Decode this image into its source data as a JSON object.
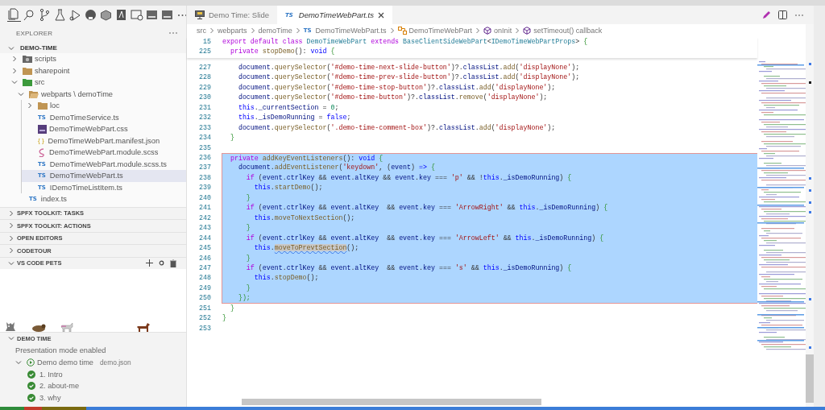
{
  "sidebar": {
    "title": "EXPLORER",
    "root": {
      "label": "DEMO-TIME",
      "expanded": true
    },
    "tree": [
      {
        "label": "scripts",
        "kind": "folder-gear",
        "expanded": false,
        "selected": false
      },
      {
        "label": "sharepoint",
        "kind": "folder",
        "expanded": false,
        "selected": false
      },
      {
        "label": "src",
        "kind": "folder-green",
        "expanded": true,
        "selected": false,
        "children": [
          {
            "label": "webparts \\ demoTime",
            "kind": "folder-open",
            "expanded": true,
            "selected": false,
            "children": [
              {
                "label": "loc",
                "kind": "folder",
                "expanded": false,
                "selected": false
              },
              {
                "label": "DemoTimeService.ts",
                "kind": "ts",
                "badge": "TS",
                "selected": false
              },
              {
                "label": "DemoTimeWebPart.css",
                "kind": "css",
                "selected": false
              },
              {
                "label": "DemoTimeWebPart.manifest.json",
                "kind": "json",
                "badge": "{ }",
                "selected": false
              },
              {
                "label": "DemoTimeWebPart.module.scss",
                "kind": "sass",
                "selected": false
              },
              {
                "label": "DemoTimeWebPart.module.scss.ts",
                "kind": "ts",
                "badge": "TS",
                "selected": false
              },
              {
                "label": "DemoTimeWebPart.ts",
                "kind": "ts",
                "badge": "TS",
                "selected": true
              },
              {
                "label": "IDemoTimeListItem.ts",
                "kind": "ts",
                "badge": "TS",
                "selected": false
              }
            ]
          },
          {
            "label": "index.ts",
            "kind": "ts",
            "badge": "TS",
            "selected": false
          }
        ]
      }
    ],
    "panels": [
      {
        "kind": "header",
        "title": "SPFX TOOLKIT: TASKS",
        "expanded": false
      },
      {
        "kind": "header",
        "title": "SPFX TOOLKIT: ACTIONS",
        "expanded": false
      },
      {
        "kind": "header",
        "title": "OPEN EDITORS",
        "expanded": false
      },
      {
        "kind": "header",
        "title": "CODETOUR",
        "expanded": false
      },
      {
        "kind": "pets",
        "title": "VS CODE PETS",
        "expanded": true
      },
      {
        "kind": "demo",
        "title": "DEMO TIME",
        "expanded": true,
        "status": "Presentation mode enabled",
        "demo": {
          "label": "Demo demo time",
          "file": "demo.json",
          "expanded": true,
          "steps": [
            {
              "label": "1. Intro",
              "done": true
            },
            {
              "label": "2. about-me",
              "done": true
            },
            {
              "label": "3. why",
              "done": true
            }
          ]
        }
      }
    ]
  },
  "tabs": [
    {
      "label": "Demo Time: Slide",
      "kind": "slide",
      "selected": false
    },
    {
      "label": "DemoTimeWebPart.ts",
      "kind": "ts",
      "badge": "TS",
      "selected": true
    }
  ],
  "breadcrumbs": [
    {
      "label": "src",
      "kind": "folder"
    },
    {
      "label": "webparts",
      "kind": "folder"
    },
    {
      "label": "demoTime",
      "kind": "folder"
    },
    {
      "label": "DemoTimeWebPart.ts",
      "kind": "ts",
      "badge": "TS"
    },
    {
      "label": "DemoTimeWebPart",
      "kind": "class"
    },
    {
      "label": "onInit",
      "kind": "method"
    },
    {
      "label": "setTimeout() callback",
      "kind": "method"
    }
  ],
  "sticky": [
    {
      "number": "15",
      "tokens": [
        {
          "kind": "k",
          "text": "export "
        },
        {
          "kind": "k",
          "text": "default "
        },
        {
          "kind": "k",
          "text": "class "
        },
        {
          "kind": "t",
          "text": "DemoTimeWebPart "
        },
        {
          "kind": "k",
          "text": "extends "
        },
        {
          "kind": "t",
          "text": "BaseClientSideWebPart"
        },
        {
          "kind": "p",
          "text": "<"
        },
        {
          "kind": "t",
          "text": "IDemoTimeWebPartProps"
        },
        {
          "kind": "p",
          "text": "> "
        },
        {
          "kind": "r",
          "text": "{"
        }
      ]
    },
    {
      "number": "225",
      "tokens": [
        {
          "kind": "k",
          "text": "  private "
        },
        {
          "kind": "f",
          "text": "stopDemo"
        },
        {
          "kind": "p",
          "text": "(): "
        },
        {
          "kind": "b",
          "text": "void "
        },
        {
          "kind": "r",
          "text": "{"
        }
      ]
    }
  ],
  "lines": [
    {
      "number": "227",
      "selected": false,
      "tokens": [
        {
          "kind": "i",
          "text": "    document"
        },
        {
          "kind": "p",
          "text": "."
        },
        {
          "kind": "f",
          "text": "querySelector"
        },
        {
          "kind": "p",
          "text": "("
        },
        {
          "kind": "s",
          "text": "'#demo-time-next-slide-button'"
        },
        {
          "kind": "p",
          "text": ")?."
        },
        {
          "kind": "i",
          "text": "classList"
        },
        {
          "kind": "p",
          "text": "."
        },
        {
          "kind": "f",
          "text": "add"
        },
        {
          "kind": "p",
          "text": "("
        },
        {
          "kind": "s",
          "text": "'displayNone'"
        },
        {
          "kind": "p",
          "text": ");"
        }
      ]
    },
    {
      "number": "228",
      "selected": false,
      "tokens": [
        {
          "kind": "i",
          "text": "    document"
        },
        {
          "kind": "p",
          "text": "."
        },
        {
          "kind": "f",
          "text": "querySelector"
        },
        {
          "kind": "p",
          "text": "("
        },
        {
          "kind": "s",
          "text": "'#demo-time-prev-slide-button'"
        },
        {
          "kind": "p",
          "text": ")?."
        },
        {
          "kind": "i",
          "text": "classList"
        },
        {
          "kind": "p",
          "text": "."
        },
        {
          "kind": "f",
          "text": "add"
        },
        {
          "kind": "p",
          "text": "("
        },
        {
          "kind": "s",
          "text": "'displayNone'"
        },
        {
          "kind": "p",
          "text": ");"
        }
      ]
    },
    {
      "number": "229",
      "selected": false,
      "tokens": [
        {
          "kind": "i",
          "text": "    document"
        },
        {
          "kind": "p",
          "text": "."
        },
        {
          "kind": "f",
          "text": "querySelector"
        },
        {
          "kind": "p",
          "text": "("
        },
        {
          "kind": "s",
          "text": "'#demo-time-stop-button'"
        },
        {
          "kind": "p",
          "text": ")?."
        },
        {
          "kind": "i",
          "text": "classList"
        },
        {
          "kind": "p",
          "text": "."
        },
        {
          "kind": "f",
          "text": "add"
        },
        {
          "kind": "p",
          "text": "("
        },
        {
          "kind": "s",
          "text": "'displayNone'"
        },
        {
          "kind": "p",
          "text": ");"
        }
      ]
    },
    {
      "number": "230",
      "selected": false,
      "tokens": [
        {
          "kind": "i",
          "text": "    document"
        },
        {
          "kind": "p",
          "text": "."
        },
        {
          "kind": "f",
          "text": "querySelector"
        },
        {
          "kind": "p",
          "text": "("
        },
        {
          "kind": "s",
          "text": "'#demo-time-button'"
        },
        {
          "kind": "p",
          "text": ")?."
        },
        {
          "kind": "i",
          "text": "classList"
        },
        {
          "kind": "p",
          "text": "."
        },
        {
          "kind": "f",
          "text": "remove"
        },
        {
          "kind": "p",
          "text": "("
        },
        {
          "kind": "s",
          "text": "'displayNone'"
        },
        {
          "kind": "p",
          "text": ");"
        }
      ]
    },
    {
      "number": "231",
      "selected": false,
      "tokens": [
        {
          "kind": "b",
          "text": "    this"
        },
        {
          "kind": "p",
          "text": "."
        },
        {
          "kind": "i",
          "text": "_currentSection"
        },
        {
          "kind": "p",
          "text": " = "
        },
        {
          "kind": "n",
          "text": "0"
        },
        {
          "kind": "p",
          "text": ";"
        }
      ]
    },
    {
      "number": "232",
      "selected": false,
      "tokens": [
        {
          "kind": "b",
          "text": "    this"
        },
        {
          "kind": "p",
          "text": "."
        },
        {
          "kind": "i",
          "text": "_isDemoRunning"
        },
        {
          "kind": "p",
          "text": " = "
        },
        {
          "kind": "b",
          "text": "false"
        },
        {
          "kind": "p",
          "text": ";"
        }
      ]
    },
    {
      "number": "233",
      "selected": false,
      "tokens": [
        {
          "kind": "i",
          "text": "    document"
        },
        {
          "kind": "p",
          "text": "."
        },
        {
          "kind": "f",
          "text": "querySelector"
        },
        {
          "kind": "p",
          "text": "("
        },
        {
          "kind": "s",
          "text": "'.demo-time-comment-box'"
        },
        {
          "kind": "p",
          "text": ")?."
        },
        {
          "kind": "i",
          "text": "classList"
        },
        {
          "kind": "p",
          "text": "."
        },
        {
          "kind": "f",
          "text": "add"
        },
        {
          "kind": "p",
          "text": "("
        },
        {
          "kind": "s",
          "text": "'displayNone'"
        },
        {
          "kind": "p",
          "text": ");"
        }
      ]
    },
    {
      "number": "234",
      "selected": false,
      "tokens": [
        {
          "kind": "r",
          "text": "  }"
        }
      ]
    },
    {
      "number": "235",
      "selected": false
    },
    {
      "number": "236",
      "selected": true,
      "tokens": [
        {
          "kind": "k",
          "text": "  private "
        },
        {
          "kind": "f",
          "text": "addKeyEventListeners"
        },
        {
          "kind": "p",
          "text": "(): "
        },
        {
          "kind": "b",
          "text": "void "
        },
        {
          "kind": "r",
          "text": "{"
        }
      ]
    },
    {
      "number": "237",
      "selected": true,
      "tokens": [
        {
          "kind": "i",
          "text": "    document"
        },
        {
          "kind": "p",
          "text": "."
        },
        {
          "kind": "f",
          "text": "addEventListener"
        },
        {
          "kind": "p",
          "text": "("
        },
        {
          "kind": "s",
          "text": "'keydown'"
        },
        {
          "kind": "p",
          "text": ", ("
        },
        {
          "kind": "i",
          "text": "event"
        },
        {
          "kind": "p",
          "text": ") "
        },
        {
          "kind": "b",
          "text": "=>"
        },
        {
          "kind": "r",
          "text": " {"
        }
      ]
    },
    {
      "number": "238",
      "selected": true,
      "tokens": [
        {
          "kind": "k",
          "text": "      if "
        },
        {
          "kind": "p",
          "text": "("
        },
        {
          "kind": "i",
          "text": "event"
        },
        {
          "kind": "p",
          "text": "."
        },
        {
          "kind": "i",
          "text": "ctrlKey"
        },
        {
          "kind": "p",
          "text": " && "
        },
        {
          "kind": "i",
          "text": "event"
        },
        {
          "kind": "p",
          "text": "."
        },
        {
          "kind": "i",
          "text": "altKey"
        },
        {
          "kind": "p",
          "text": " && "
        },
        {
          "kind": "i",
          "text": "event"
        },
        {
          "kind": "p",
          "text": "."
        },
        {
          "kind": "i",
          "text": "key"
        },
        {
          "kind": "p",
          "text": " === "
        },
        {
          "kind": "s",
          "text": "'p'"
        },
        {
          "kind": "p",
          "text": " && !"
        },
        {
          "kind": "b",
          "text": "this"
        },
        {
          "kind": "p",
          "text": "."
        },
        {
          "kind": "i",
          "text": "_isDemoRunning"
        },
        {
          "kind": "p",
          "text": ") "
        },
        {
          "kind": "r",
          "text": "{"
        }
      ]
    },
    {
      "number": "239",
      "selected": true,
      "tokens": [
        {
          "kind": "b",
          "text": "        this"
        },
        {
          "kind": "p",
          "text": "."
        },
        {
          "kind": "f",
          "text": "startDemo"
        },
        {
          "kind": "p",
          "text": "();"
        }
      ]
    },
    {
      "number": "240",
      "selected": true,
      "tokens": [
        {
          "kind": "r",
          "text": "      }"
        }
      ]
    },
    {
      "number": "241",
      "selected": true,
      "tokens": [
        {
          "kind": "k",
          "text": "      if "
        },
        {
          "kind": "p",
          "text": "("
        },
        {
          "kind": "i",
          "text": "event"
        },
        {
          "kind": "p",
          "text": "."
        },
        {
          "kind": "i",
          "text": "ctrlKey"
        },
        {
          "kind": "p",
          "text": " && "
        },
        {
          "kind": "i",
          "text": "event"
        },
        {
          "kind": "p",
          "text": "."
        },
        {
          "kind": "i",
          "text": "altKey"
        },
        {
          "kind": "p",
          "text": "  && "
        },
        {
          "kind": "i",
          "text": "event"
        },
        {
          "kind": "p",
          "text": "."
        },
        {
          "kind": "i",
          "text": "key"
        },
        {
          "kind": "p",
          "text": " === "
        },
        {
          "kind": "s",
          "text": "'ArrowRight'"
        },
        {
          "kind": "p",
          "text": " && "
        },
        {
          "kind": "b",
          "text": "this"
        },
        {
          "kind": "p",
          "text": "."
        },
        {
          "kind": "i",
          "text": "_isDemoRunning"
        },
        {
          "kind": "p",
          "text": ") "
        },
        {
          "kind": "r",
          "text": "{"
        }
      ]
    },
    {
      "number": "242",
      "selected": true,
      "tokens": [
        {
          "kind": "b",
          "text": "        this"
        },
        {
          "kind": "p",
          "text": "."
        },
        {
          "kind": "f",
          "text": "moveToNextSection"
        },
        {
          "kind": "p",
          "text": "();"
        }
      ]
    },
    {
      "number": "243",
      "selected": true,
      "tokens": [
        {
          "kind": "r",
          "text": "      }"
        }
      ]
    },
    {
      "number": "244",
      "selected": true,
      "tokens": [
        {
          "kind": "k",
          "text": "      if "
        },
        {
          "kind": "p",
          "text": "("
        },
        {
          "kind": "i",
          "text": "event"
        },
        {
          "kind": "p",
          "text": "."
        },
        {
          "kind": "i",
          "text": "ctrlKey"
        },
        {
          "kind": "p",
          "text": " && "
        },
        {
          "kind": "i",
          "text": "event"
        },
        {
          "kind": "p",
          "text": "."
        },
        {
          "kind": "i",
          "text": "altKey"
        },
        {
          "kind": "p",
          "text": "  && "
        },
        {
          "kind": "i",
          "text": "event"
        },
        {
          "kind": "p",
          "text": "."
        },
        {
          "kind": "i",
          "text": "key"
        },
        {
          "kind": "p",
          "text": " === "
        },
        {
          "kind": "s",
          "text": "'ArrowLeft'"
        },
        {
          "kind": "p",
          "text": " && "
        },
        {
          "kind": "b",
          "text": "this"
        },
        {
          "kind": "p",
          "text": "."
        },
        {
          "kind": "i",
          "text": "_isDemoRunning"
        },
        {
          "kind": "p",
          "text": ") "
        },
        {
          "kind": "r",
          "text": "{"
        }
      ]
    },
    {
      "number": "245",
      "selected": true,
      "tokens": [
        {
          "kind": "b",
          "text": "        this"
        },
        {
          "kind": "p",
          "text": "."
        },
        {
          "kind": "h",
          "text": "moveToPrevtSection"
        },
        {
          "kind": "p",
          "text": "();"
        }
      ]
    },
    {
      "number": "246",
      "selected": true,
      "tokens": [
        {
          "kind": "r",
          "text": "      }"
        }
      ]
    },
    {
      "number": "247",
      "selected": true,
      "tokens": [
        {
          "kind": "k",
          "text": "      if "
        },
        {
          "kind": "p",
          "text": "("
        },
        {
          "kind": "i",
          "text": "event"
        },
        {
          "kind": "p",
          "text": "."
        },
        {
          "kind": "i",
          "text": "ctrlKey"
        },
        {
          "kind": "p",
          "text": " && "
        },
        {
          "kind": "i",
          "text": "event"
        },
        {
          "kind": "p",
          "text": "."
        },
        {
          "kind": "i",
          "text": "altKey"
        },
        {
          "kind": "p",
          "text": "  && "
        },
        {
          "kind": "i",
          "text": "event"
        },
        {
          "kind": "p",
          "text": "."
        },
        {
          "kind": "i",
          "text": "key"
        },
        {
          "kind": "p",
          "text": " === "
        },
        {
          "kind": "s",
          "text": "'s'"
        },
        {
          "kind": "p",
          "text": " && "
        },
        {
          "kind": "b",
          "text": "this"
        },
        {
          "kind": "p",
          "text": "."
        },
        {
          "kind": "i",
          "text": "_isDemoRunning"
        },
        {
          "kind": "p",
          "text": ") "
        },
        {
          "kind": "r",
          "text": "{"
        }
      ]
    },
    {
      "number": "248",
      "selected": true,
      "tokens": [
        {
          "kind": "b",
          "text": "        this"
        },
        {
          "kind": "p",
          "text": "."
        },
        {
          "kind": "f",
          "text": "stopDemo"
        },
        {
          "kind": "p",
          "text": "();"
        }
      ]
    },
    {
      "number": "249",
      "selected": true,
      "tokens": [
        {
          "kind": "r",
          "text": "      }"
        }
      ]
    },
    {
      "number": "250",
      "selected": true,
      "tokens": [
        {
          "kind": "r",
          "text": "    });"
        }
      ]
    },
    {
      "number": "251",
      "selected": false,
      "tokens": [
        {
          "kind": "r",
          "text": "  }"
        }
      ]
    },
    {
      "number": "252",
      "selected": false,
      "tokens": [
        {
          "kind": "r",
          "text": "}"
        }
      ]
    },
    {
      "number": "253",
      "selected": false
    }
  ]
}
